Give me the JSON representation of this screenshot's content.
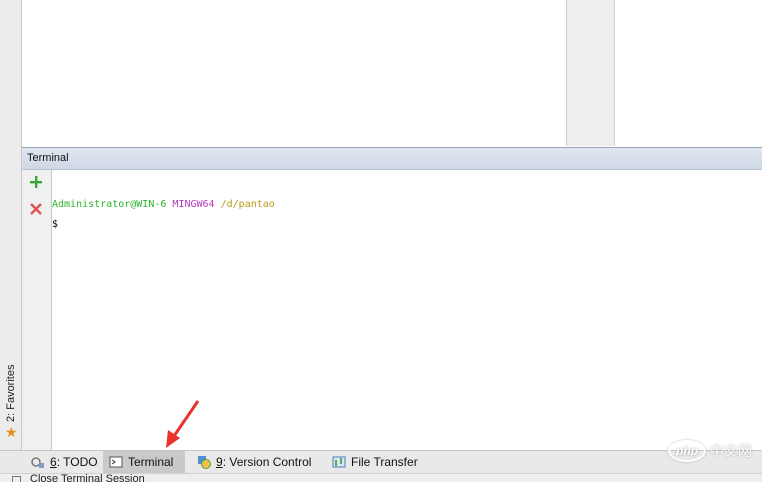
{
  "left_panel": {
    "favorites_label": "2: Favorites",
    "favorites_icon": "star-icon"
  },
  "terminal": {
    "title": "Terminal",
    "toolbar": {
      "add_icon": "plus-icon",
      "close_icon": "close-icon"
    },
    "prompt": {
      "user_host": "Administrator@WIN-6",
      "system": "MINGW64",
      "path": "/d/pantao",
      "symbol": "$"
    }
  },
  "bottom_tabs": [
    {
      "number": "6",
      "label": "TODO",
      "icon": "todo-icon",
      "active": false
    },
    {
      "number": "",
      "label": "Terminal",
      "icon": "terminal-icon",
      "active": true
    },
    {
      "number": "9",
      "label": "Version Control",
      "icon": "version-control-icon",
      "active": false
    },
    {
      "number": "",
      "label": "File Transfer",
      "icon": "file-transfer-icon",
      "active": false
    }
  ],
  "status_bar": {
    "text": "Close Terminal Session"
  },
  "watermark": {
    "logo": "php",
    "text": "中文网"
  },
  "colors": {
    "prompt_user": "#2bb52b",
    "prompt_system": "#b43cbf",
    "prompt_path": "#b79a1a",
    "accent_arrow": "#e8322c"
  }
}
